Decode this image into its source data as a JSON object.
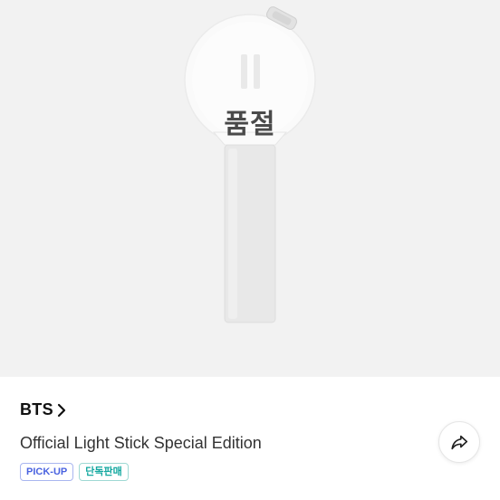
{
  "product": {
    "status_overlay": "품절",
    "image_subject": "light-stick",
    "artist": "BTS",
    "title": "Official Light Stick Special Edition",
    "badges": [
      {
        "label": "PICK-UP",
        "color": "#4a63e0"
      },
      {
        "label": "단독판매",
        "color": "#14a8a0"
      }
    ]
  },
  "icons": {
    "artist_chevron": "chevron-right-icon",
    "share": "share-arrow-icon"
  },
  "colors": {
    "hero_background": "#f2f2f2",
    "text_primary": "#111111"
  }
}
